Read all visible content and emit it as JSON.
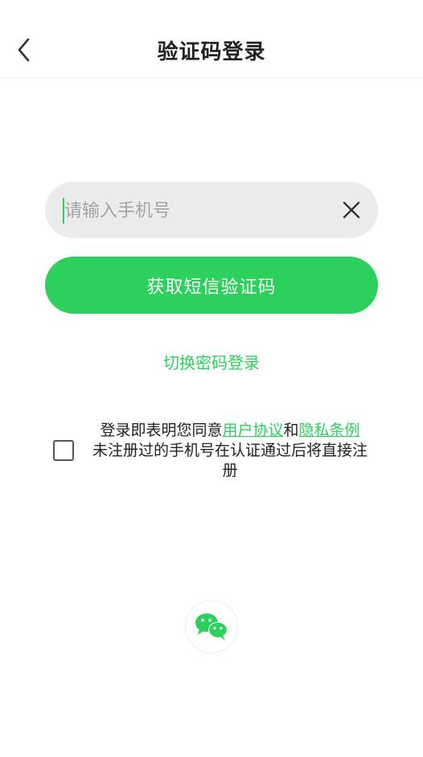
{
  "header": {
    "title": "验证码登录",
    "back_icon": "chevron-left-icon"
  },
  "phone": {
    "placeholder": "请输入手机号",
    "value": "",
    "clear_icon": "close-icon"
  },
  "sms_button": {
    "label": "获取短信验证码"
  },
  "switch_link": {
    "label": "切换密码登录"
  },
  "agreement": {
    "checked": false,
    "prefix": "登录即表明您同意",
    "user_agreement": "用户协议",
    "and": "和",
    "privacy_policy": "隐私条例",
    "note": "未注册过的手机号在认证通过后将直接注册"
  },
  "third_party": {
    "icon": "wechat-icon"
  },
  "colors": {
    "accent": "#2bd15c",
    "input_bg": "#ececec",
    "text": "#222222"
  }
}
